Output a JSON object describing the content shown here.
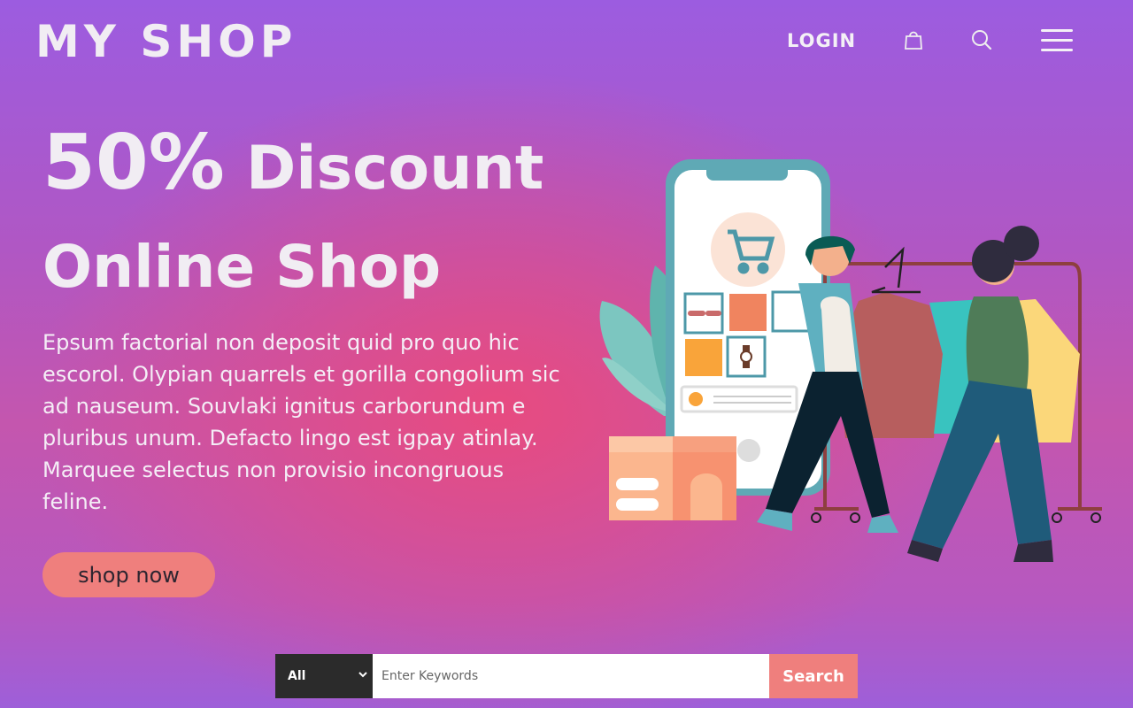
{
  "header": {
    "logo": "MY SHOP",
    "login_label": "LOGIN",
    "icons": [
      "shopping-bag-icon",
      "search-icon",
      "hamburger-menu-icon"
    ]
  },
  "hero": {
    "headline_percent": "50%",
    "headline_word": "Discount",
    "headline_line2": "Online Shop",
    "body": "Epsum factorial non deposit quid pro quo hic escorol. Olypian quarrels et gorilla congolium sic ad nauseum. Souvlaki ignitus carborundum e pluribus unum. Defacto lingo est igpay atinlay. Marquee selectus non provisio incongruous feline.",
    "cta_label": "shop now"
  },
  "search": {
    "category_selected": "All",
    "placeholder": "Enter Keywords",
    "button_label": "Search"
  },
  "colors": {
    "accent": "#ef7f7d",
    "select_bg": "#2b2b2b",
    "text_light": "#f1edf3"
  }
}
